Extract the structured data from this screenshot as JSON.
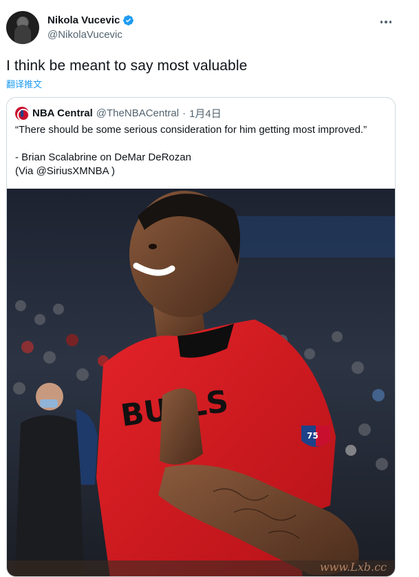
{
  "author": {
    "display_name": "Nikola Vucevic",
    "handle": "@NikolaVucevic",
    "verified": true,
    "avatar_icon": "profile-photo"
  },
  "tweet": {
    "text": "I think be meant to say most valuable",
    "translate_label": "翻译推文"
  },
  "quoted_tweet": {
    "display_name": "NBA Central",
    "handle": "@TheNBACentral",
    "separator": "·",
    "date": "1月4日",
    "body_lines": [
      "“There should be some serious consideration for him getting most improved.”",
      "",
      "- Brian Scalabrine on DeMar DeRozan",
      "(Via @SiriusXMNBA )"
    ],
    "media": {
      "description_icon": "player-photo",
      "jersey_text": "BULLS"
    }
  },
  "watermark": "www.Lxb.cc",
  "colors": {
    "link": "#1d9bf0",
    "verified": "#1d9bf0",
    "secondary_text": "#536471",
    "jersey_red": "#d7191f",
    "border": "#cfd9de"
  }
}
